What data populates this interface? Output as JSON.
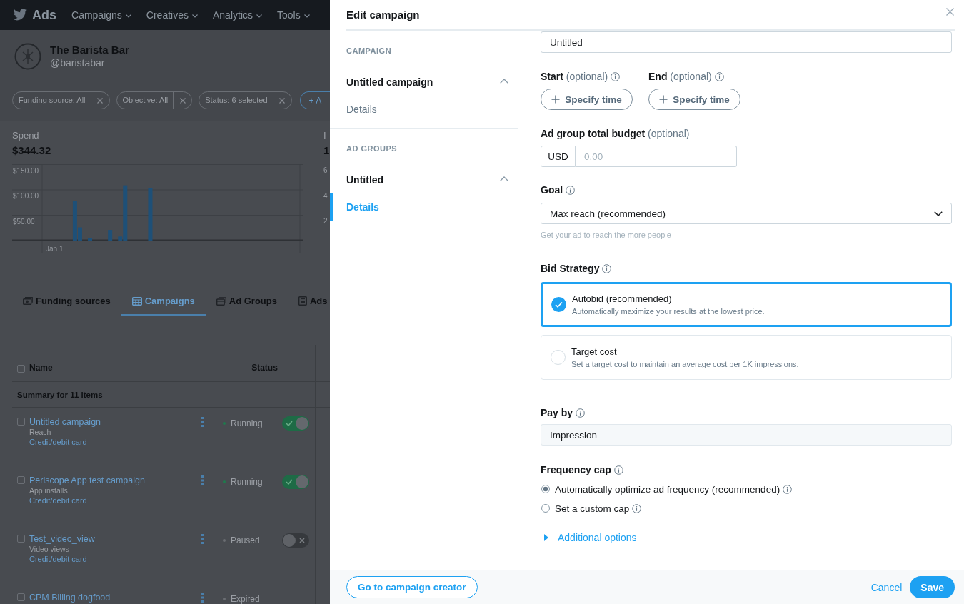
{
  "top_nav": {
    "brand": "Ads",
    "menus": [
      "Campaigns",
      "Creatives",
      "Analytics",
      "Tools"
    ]
  },
  "account": {
    "name": "The Barista Bar",
    "handle": "@baristabar"
  },
  "filters": [
    {
      "label": "Funding source: All",
      "kind": "filter"
    },
    {
      "label": "Objective: All",
      "kind": "filter"
    },
    {
      "label": "Status: 6 selected",
      "kind": "filter"
    },
    {
      "label": "+ A",
      "kind": "add"
    }
  ],
  "metrics": [
    {
      "label": "Spend",
      "value": "$344.32",
      "chart_data": {
        "type": "bar",
        "grid": true,
        "ylim": [
          0,
          150
        ],
        "yticks": [
          {
            "value": 50,
            "label": "$50.00"
          },
          {
            "value": 100,
            "label": "$100.00"
          },
          {
            "value": 150,
            "label": "$150.00"
          }
        ],
        "series": [
          {
            "color": "#1e5078",
            "values": [
              null,
              null,
              null,
              null,
              null,
              null,
              null,
              null,
              null,
              null,
              null,
              null,
              78,
              26,
              null,
              5,
              null,
              null,
              null,
              21,
              null,
              8,
              109,
              null,
              null,
              null,
              null,
              103,
              null,
              null,
              null,
              null,
              null,
              null,
              null,
              null,
              null,
              null,
              null,
              null,
              null,
              null,
              null,
              null,
              null,
              null,
              null,
              null,
              null,
              null,
              null,
              null,
              null,
              null,
              null,
              null,
              null,
              null
            ]
          }
        ],
        "annotations": [
          "Jan 1"
        ]
      }
    },
    {
      "label": "I",
      "value": "1",
      "axis_labels": [
        "6",
        "4",
        "2"
      ]
    }
  ],
  "tabs": [
    {
      "label": "Funding sources",
      "selected": false
    },
    {
      "label": "Campaigns",
      "selected": true
    },
    {
      "label": "Ad Groups",
      "selected": false
    },
    {
      "label": "Ads",
      "selected": false
    }
  ],
  "table": {
    "columns": [
      "Name",
      "Status"
    ],
    "select_all": {
      "checked": false
    },
    "summary": {
      "label": "Summary for 11 items",
      "status": "–"
    },
    "rows": [
      {
        "checked": false,
        "name": "Untitled campaign",
        "objective": "Reach",
        "billing": "Credit/debit card",
        "status": "Running",
        "color": "#1f7a4d",
        "on": true
      },
      {
        "checked": false,
        "name": "Periscope App test campaign",
        "objective": "App installs",
        "billing": "Credit/debit card",
        "status": "Running",
        "color": "#1f7a4d",
        "on": true
      },
      {
        "checked": false,
        "name": "Test_video_view",
        "objective": "Video views",
        "billing": "Credit/debit card",
        "status": "Paused",
        "color": "#6a6d72",
        "on": false
      },
      {
        "checked": false,
        "name": "CPM Billing dogfood",
        "status": "Expired",
        "color": "#6a6d72"
      }
    ]
  },
  "modal": {
    "title": "Edit campaign",
    "nav": [
      {
        "heading": "CAMPAIGN",
        "items": [
          {
            "label": "Untitled campaign",
            "expanded": true,
            "children": [
              {
                "label": "Details",
                "selected": false
              }
            ]
          }
        ]
      },
      {
        "heading": "AD GROUPS",
        "items": [
          {
            "label": "Untitled",
            "expanded": true,
            "children": [
              {
                "label": "Details",
                "selected": true
              }
            ]
          }
        ]
      }
    ],
    "form": {
      "name_field": {
        "value": "Untitled"
      },
      "schedule": [
        {
          "label": "**Start** (optional)",
          "button": "Specify time"
        },
        {
          "label": "**End** (optional)",
          "button": "Specify time"
        }
      ],
      "budget": {
        "label": "**Ad group total budget** (optional)",
        "currency": "USD",
        "placeholder": "0.00"
      },
      "goal": {
        "label": "Goal",
        "value": "Max reach (recommended)",
        "help": "Get your ad to reach the more people"
      },
      "bid_strategy": {
        "label": "Bid Strategy",
        "options": [
          {
            "title": "Autobid (recommended)",
            "description": "Automatically maximize your results at the lowest price.",
            "selected": true
          },
          {
            "title": "Target cost",
            "description": "Set a target cost to maintain an average cost per 1K impressions.",
            "selected": false
          }
        ]
      },
      "pay_by": {
        "label": "Pay by",
        "value": "Impression",
        "disabled": true
      },
      "frequency_cap": {
        "label": "Frequency cap",
        "options": [
          {
            "label": "Automatically optimize ad frequency (recommended)",
            "selected": true
          },
          {
            "label": "Set a custom cap",
            "selected": false
          }
        ]
      },
      "additional_options": {
        "label": "Additional options",
        "expanded": false
      }
    },
    "footer": {
      "creator_button": "Go to campaign creator",
      "cancel": "Cancel",
      "save": "Save"
    }
  }
}
